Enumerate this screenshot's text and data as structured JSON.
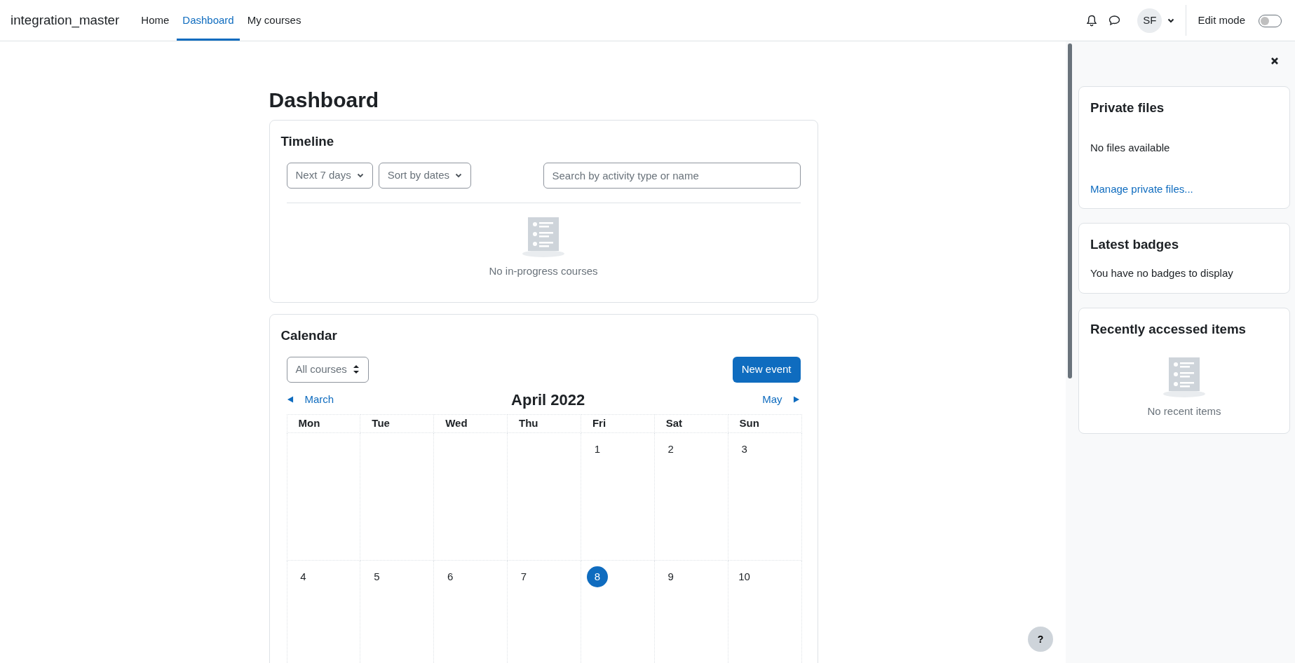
{
  "navbar": {
    "brand": "integration_master",
    "nav_items": [
      {
        "label": "Home",
        "selected": false
      },
      {
        "label": "Dashboard",
        "selected": true
      },
      {
        "label": "My courses",
        "selected": false
      }
    ],
    "user": {
      "initials": "SF"
    },
    "edit_mode": {
      "label": "Edit mode",
      "on": false
    }
  },
  "page_title": "Dashboard",
  "timeline": {
    "title": "Timeline",
    "filters": [
      "Next 7 days",
      "Sort by dates"
    ],
    "search": {
      "placeholder": "Search by activity type or name"
    },
    "empty_message": "No in-progress courses"
  },
  "calendar": {
    "title": "Calendar",
    "course_filter": "All courses",
    "new_event_button": "New event",
    "previous_month": "March",
    "month": "April 2022",
    "next_month": "May",
    "weekdays": [
      "Mon",
      "Tue",
      "Wed",
      "Thu",
      "Fri",
      "Sat",
      "Sun"
    ],
    "weeks": [
      [
        {
          "kind": "blank"
        },
        {
          "kind": "blank"
        },
        {
          "kind": "blank"
        },
        {
          "kind": "blank"
        },
        {
          "kind": "day",
          "day": "1",
          "today": false
        },
        {
          "kind": "day",
          "day": "2",
          "today": false
        },
        {
          "kind": "day",
          "day": "3",
          "today": false
        }
      ],
      [
        {
          "kind": "day",
          "day": "4",
          "today": false
        },
        {
          "kind": "day",
          "day": "5",
          "today": false
        },
        {
          "kind": "day",
          "day": "6",
          "today": false
        },
        {
          "kind": "day",
          "day": "7",
          "today": false
        },
        {
          "kind": "day",
          "day": "8",
          "today": true
        },
        {
          "kind": "day",
          "day": "9",
          "today": false
        },
        {
          "kind": "day",
          "day": "10",
          "today": false
        }
      ]
    ]
  },
  "drawer": {
    "blocks": [
      {
        "kind": "files",
        "title": "Private files",
        "message": "No files available",
        "link": "Manage private files..."
      },
      {
        "kind": "text",
        "title": "Latest badges",
        "message": "You have no badges to display"
      },
      {
        "kind": "empty",
        "title": "Recently accessed items",
        "message": "No recent items"
      }
    ]
  },
  "help_button": "?"
}
